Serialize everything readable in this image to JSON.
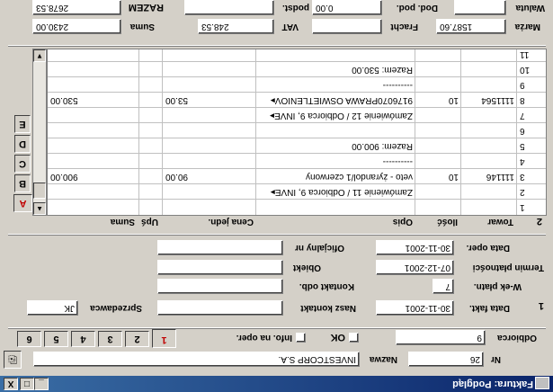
{
  "window": {
    "title": "Faktura: Podgląd",
    "minimize": "_",
    "maximize": "□",
    "close": "X"
  },
  "top": {
    "nr_label": "Nr",
    "nr_value": "26",
    "nazwa_label": "Nazwa",
    "nazwa_value": "INVESTCORP S.A.",
    "odbiorca_label": "Odbiorca",
    "odbiorca_value": "9",
    "ok_label": "OK",
    "info_label": "Info. na oper.",
    "tabs": [
      "1",
      "2",
      "3",
      "4",
      "5",
      "6"
    ]
  },
  "section1": {
    "number": "1",
    "data_fakt_label": "Data fakt.",
    "data_fakt_value": "30-11-2001",
    "wek_label": "W-ek płatn.",
    "wek_value": "7",
    "termin_label": "Termin płatności",
    "termin_value": "07-12-2001",
    "data_oper_label": "Data oper.",
    "data_oper_value": "30-11-2001",
    "nasz_kontakt_label": "Nasz kontakt",
    "nasz_kontakt_value": "",
    "kontakt_odb_label": "Kontakt odb.",
    "kontakt_odb_value": "",
    "obiekt_label": "Obiekt",
    "obiekt_value": "",
    "oficjalny_label": "Oficjalny nr",
    "oficjalny_value": "",
    "sprzedawca_label": "Sprzedawca",
    "sprzedawca_value": "JK"
  },
  "section2": {
    "number": "2",
    "columns": [
      "Towar",
      "Ilość",
      "Opis",
      "Cena jedn.",
      "Upś",
      "Suma"
    ],
    "rows": [
      {
        "n": "1",
        "towar": "",
        "ilosc": "",
        "opis": "",
        "cena": "",
        "suma": ""
      },
      {
        "n": "2",
        "towar": "",
        "ilosc": "",
        "opis": "Zamówienie 11 / Odbiorca 9, INVE▸",
        "cena": "",
        "suma": ""
      },
      {
        "n": "3",
        "towar": "111146",
        "ilosc": "10",
        "opis": "veto - żyrandol/1 czerwony",
        "cena": "90.00",
        "suma": "900.00"
      },
      {
        "n": "4",
        "towar": "",
        "ilosc": "",
        "opis": "----------",
        "cena": "",
        "suma": ""
      },
      {
        "n": "5",
        "towar": "",
        "ilosc": "",
        "opis": "Razem: 900.00",
        "cena": "",
        "suma": ""
      },
      {
        "n": "6",
        "towar": "",
        "ilosc": "",
        "opis": "",
        "cena": "",
        "suma": ""
      },
      {
        "n": "7",
        "towar": "",
        "ilosc": "",
        "opis": "Zamówienie 12 / Odbiorca 9, INVE▸",
        "cena": "",
        "suma": ""
      },
      {
        "n": "8",
        "towar": "1111564",
        "ilosc": "10",
        "opis": "9176070PRAWA OSWIETLENIOV▸",
        "cena": "53.00",
        "suma": "530.00"
      },
      {
        "n": "9",
        "towar": "",
        "ilosc": "",
        "opis": "----------",
        "cena": "",
        "suma": ""
      },
      {
        "n": "10",
        "towar": "",
        "ilosc": "",
        "opis": "Razem: 530.00",
        "cena": "",
        "suma": ""
      },
      {
        "n": "11",
        "towar": "",
        "ilosc": "",
        "opis": "",
        "cena": "",
        "suma": ""
      }
    ],
    "side_tabs": [
      "A",
      "B",
      "C",
      "D",
      "E"
    ]
  },
  "totals": {
    "marza_label": "Marża",
    "marza_value": "1587.60",
    "fracht_label": "Fracht",
    "fracht_value": "",
    "vat_label": "VAT",
    "vat_value": "248.53",
    "suma_label": "Suma",
    "suma_value": "2430.00",
    "waluta_label": "Waluta",
    "waluta_value": "",
    "dod_pod_label": "Dod. pod.",
    "dod_pod_value": "0.00",
    "podst_label": "podst.",
    "podst_value": "",
    "razem_label": "RAZEM",
    "razem_value": "2678.53"
  }
}
